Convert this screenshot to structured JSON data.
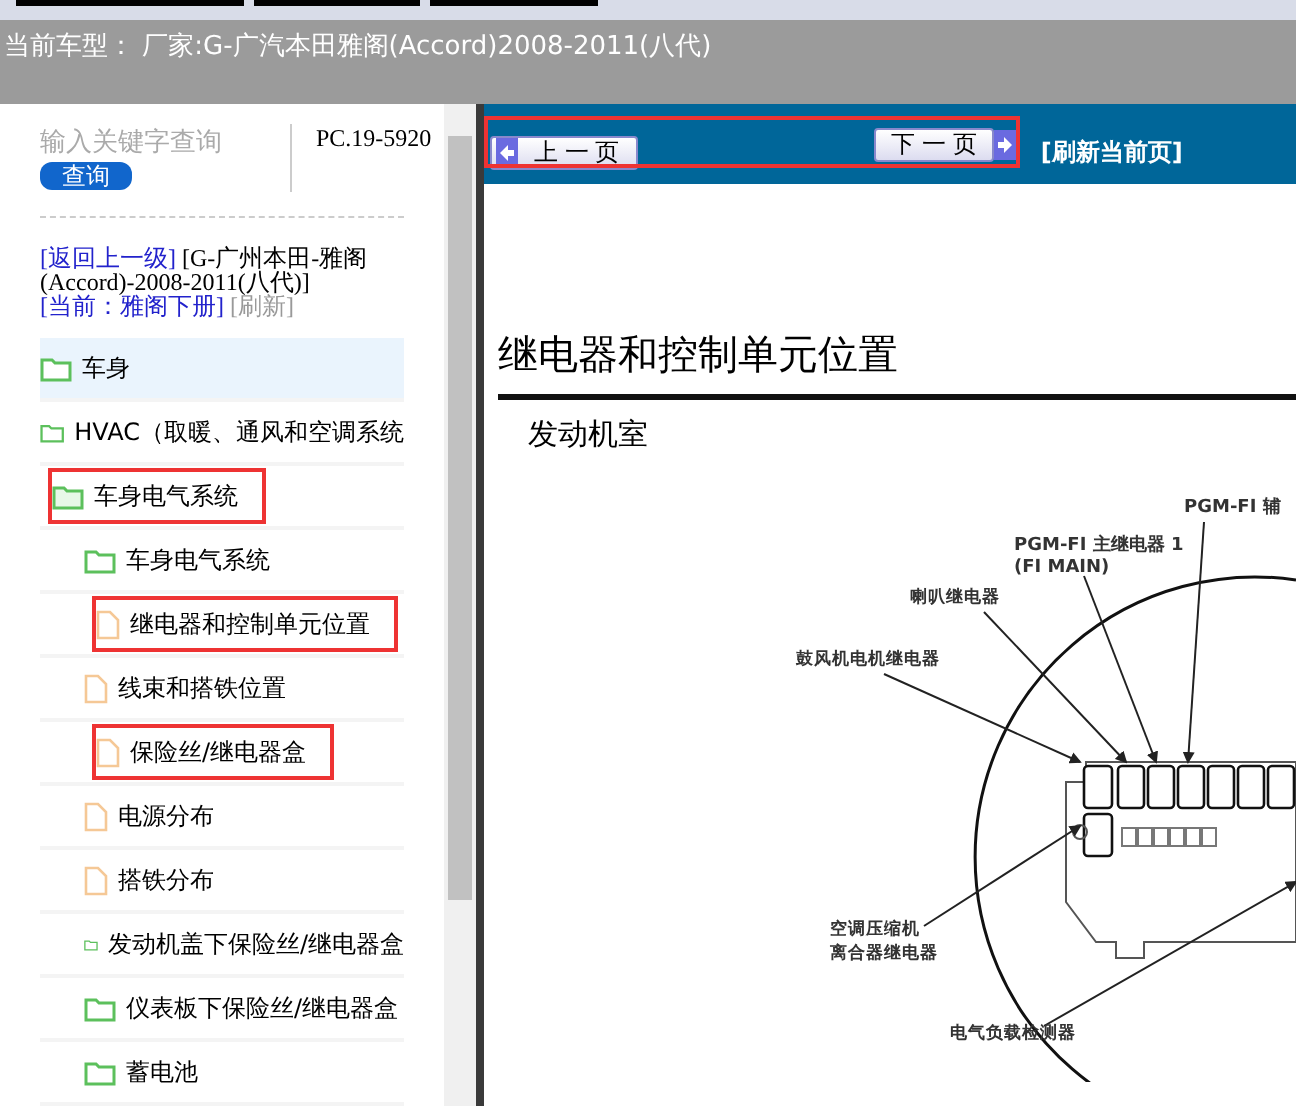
{
  "header": {
    "title": "当前车型： 厂家:G-广汽本田雅阁(Accord)2008-2011(八代)"
  },
  "search": {
    "placeholder": "输入关键字查询",
    "button": "查询",
    "code": "PC.19-5920"
  },
  "breadcrumb": {
    "back": "[返回上一级]",
    "path": "[G-广州本田-雅阁(Accord)-2008-2011(八代)]",
    "current": "[当前：雅阁下册]",
    "refresh": "[刷新]"
  },
  "tree": [
    {
      "label": "车身",
      "kind": "folder",
      "selected": true,
      "highlighted": false
    },
    {
      "label": "HVAC（取暖、通风和空调系统",
      "kind": "folder",
      "selected": false,
      "highlighted": false
    },
    {
      "label": "车身电气系统",
      "kind": "folder",
      "selected": false,
      "highlighted": true,
      "expanded": true,
      "children": [
        {
          "label": "车身电气系统",
          "kind": "folder",
          "selected": false,
          "highlighted": false
        },
        {
          "label": "继电器和控制单元位置",
          "kind": "document",
          "selected": false,
          "highlighted": true
        },
        {
          "label": "线束和搭铁位置",
          "kind": "document",
          "selected": false,
          "highlighted": false
        },
        {
          "label": "保险丝/继电器盒",
          "kind": "document",
          "selected": false,
          "highlighted": true
        },
        {
          "label": "电源分布",
          "kind": "document",
          "selected": false,
          "highlighted": false
        },
        {
          "label": "搭铁分布",
          "kind": "document",
          "selected": false,
          "highlighted": false
        },
        {
          "label": "发动机盖下保险丝/继电器盒",
          "kind": "folder",
          "selected": false,
          "highlighted": false
        },
        {
          "label": "仪表板下保险丝/继电器盒",
          "kind": "folder",
          "selected": false,
          "highlighted": false
        },
        {
          "label": "蓄电池",
          "kind": "folder",
          "selected": false,
          "highlighted": false
        }
      ]
    }
  ],
  "nav": {
    "prev": "上 一 页",
    "next": "下 一 页",
    "refresh": "[刷新当前页]",
    "highlighted": true
  },
  "document": {
    "title": "继电器和控制单元位置",
    "subtitle": "发动机室",
    "labels": [
      "PGM-FI 辅",
      "PGM-FI 主继电器 1",
      "(FI MAIN)",
      "喇叭继电器",
      "鼓风机电机继电器",
      "空调压缩机",
      "离合器继电器",
      "电气负载检测器"
    ]
  }
}
